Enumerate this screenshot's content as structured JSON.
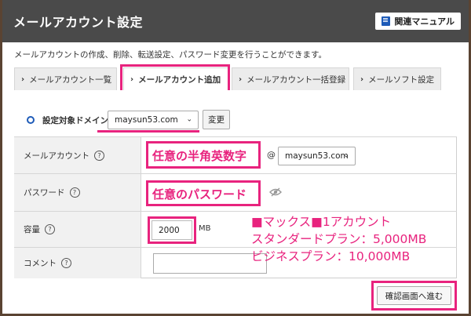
{
  "header": {
    "title": "メールアカウント設定",
    "manual_button": "関連マニュアル"
  },
  "description": "メールアカウントの作成、削除、転送設定、パスワード変更を行うことができます。",
  "tabs": [
    {
      "label": "メールアカウント一覧",
      "active": false
    },
    {
      "label": "メールアカウント追加",
      "active": true
    },
    {
      "label": "メールアカウント一括登録",
      "active": false
    },
    {
      "label": "メールソフト設定",
      "active": false
    }
  ],
  "domain": {
    "label": "設定対象ドメイン",
    "selected": "maysun53.com",
    "change_button": "変更"
  },
  "form": {
    "account": {
      "label": "メールアカウント",
      "value": "任意の半角英数字",
      "at": "@",
      "domain_selected": "maysun53.com"
    },
    "password": {
      "label": "パスワード",
      "value": "任意のパスワード"
    },
    "capacity": {
      "label": "容量",
      "value": "2000",
      "unit": "MB"
    },
    "comment": {
      "label": "コメント",
      "value": ""
    }
  },
  "help_glyph": "?",
  "annotations": {
    "line1": "■マックス■1アカウント",
    "line2": "スタンダードプラン：5,000MB",
    "line3": "ビジネスプラン：10,000MB"
  },
  "confirm_button": "確認画面へ進む",
  "colors": {
    "header_bg": "#4a4a4a",
    "highlight": "#e8237e",
    "radio": "#1e5bb8"
  }
}
